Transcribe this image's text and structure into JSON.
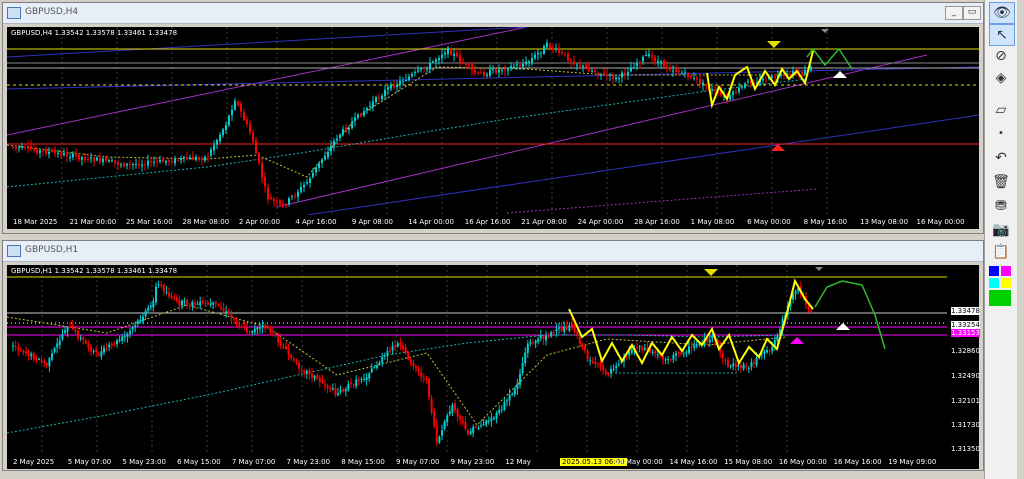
{
  "windows": [
    {
      "title": "GBPUSD,H4",
      "header": "GBPUSD,H4  1.33542 1.33578 1.33461 1.33478",
      "xticks": [
        "18 Mar 2025",
        "21 Mar 00:00",
        "25 Mar 16:00",
        "28 Mar 08:00",
        "2 Apr 00:00",
        "4 Apr 16:00",
        "9 Apr 08:00",
        "14 Apr 00:00",
        "16 Apr 16:00",
        "21 Apr 08:00",
        "24 Apr 00:00",
        "28 Apr 16:00",
        "1 May 08:00",
        "6 May 00:00",
        "8 May 16:00",
        "13 May 08:00",
        "16 May 00:00"
      ]
    },
    {
      "title": "GBPUSD,H1",
      "header": "GBPUSD,H1  1.33542 1.33578 1.33461 1.33478",
      "xticks": [
        "2 May 2025",
        "5 May 07:00",
        "5 May 23:00",
        "6 May 15:00",
        "7 May 07:00",
        "7 May 23:00",
        "8 May 15:00",
        "9 May 07:00",
        "9 May 23:00",
        "12 May",
        "2025.05.13 06:00",
        "14 May 00:00",
        "14 May 16:00",
        "15 May 08:00",
        "16 May 00:00",
        "16 May 16:00",
        "19 May 09:00"
      ],
      "yticks": [
        "1.33478",
        "1.33254",
        "1.33153",
        "1.32860",
        "1.32490",
        "1.32101",
        "1.31730",
        "1.31350"
      ]
    }
  ],
  "colors": {
    "bull": "#00ced1",
    "bear": "#ff0000",
    "signal_line": "#ffff00",
    "projection": "#2eb82e",
    "hline_yellow": "#e0e000",
    "hline_red": "#ff2020",
    "hline_magenta": "#ff00ff",
    "channel_magenta": "#a030c0",
    "channel_blue": "#3030c0",
    "ma_cyan": "#20b0b0",
    "ma_yellow": "#c0c040",
    "active_tag": "#ffff00"
  },
  "toolbar": {
    "icons": [
      "eye-icon",
      "cursor-icon",
      "crosshair-icon",
      "eraser-icon",
      "ruler-icon",
      "undo-icon",
      "trash-icon",
      "magnet-icon",
      "camera-icon",
      "clipboard-icon"
    ]
  }
}
